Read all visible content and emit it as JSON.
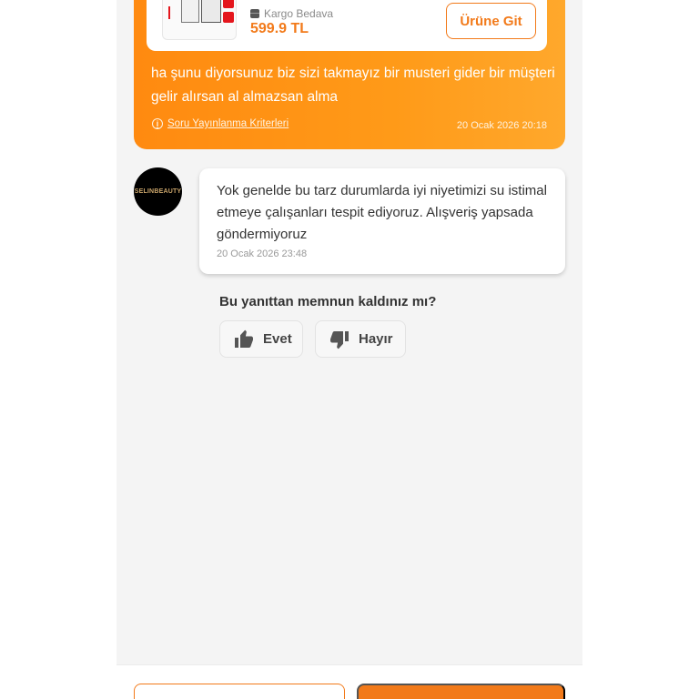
{
  "question_card": {
    "product": {
      "shipping_label": "Kargo Bedava",
      "price": "599.9 TL",
      "goto_button": "Ürüne Git"
    },
    "question_text": "ha şunu diyorsunuz biz sizi takmayız bir musteri gider bir müşteri gelir alırsan al almazsan alma",
    "criteria_link": "Soru Yayınlanma Kriterleri",
    "date": "20 Ocak 2026 20:18"
  },
  "answer": {
    "avatar_text": "SELINBEAUTY",
    "text": "Yok genelde bu tarz durumlarda iyi niyetimizi su istimal etmeye çalışanları tespit ediyoruz. Alışveriş yapsada göndermiyoruz",
    "date": "20 Ocak 2026 23:48"
  },
  "feedback": {
    "question": "Bu yanıttan memnun kaldınız mı?",
    "yes_label": "Evet",
    "no_label": "Hayır"
  },
  "colors": {
    "accent": "#f27a1a",
    "card_start": "#ff8a10",
    "card_end": "#ffa82c"
  }
}
